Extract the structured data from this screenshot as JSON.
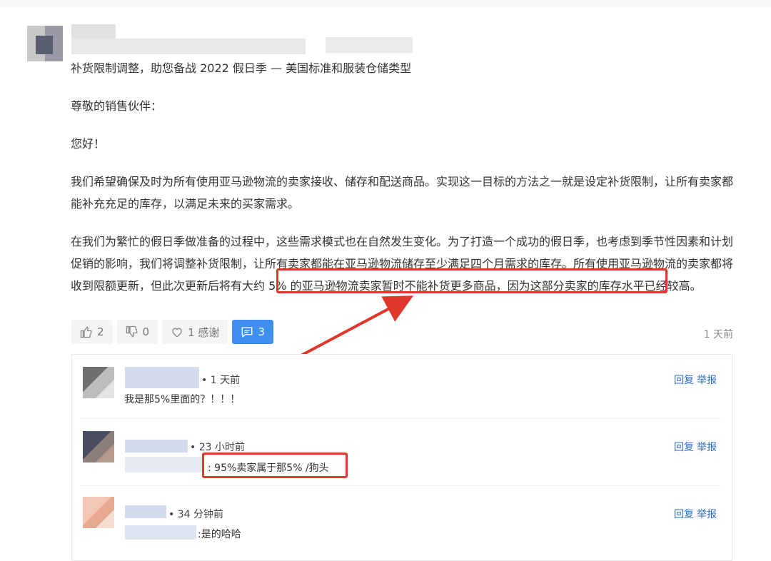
{
  "post": {
    "title": "补货限制调整，助您备战 2022 假日季 — 美国标准和服装仓储类型",
    "greeting1": "尊敬的销售伙伴：",
    "greeting2": "您好！",
    "para1": "我们希望确保及时为所有使用亚马逊物流的卖家接收、储存和配送商品。实现这一目标的方法之一就是设定补货限制，让所有卖家都能补充充足的库存，以满足未来的买家需求。",
    "para2_before": "在我们为繁忙的假日季做准备的过程中，这些需求模式也在自然发生变化。为了打造一个成功的假日季，也考虑到季节性因素和计划促销的影响，我们将调整补货限制，让所有卖家都能在亚马逊物流储存至少满足四个月需求的库存。所有使用亚马逊物流的卖家都将收到限额更新，",
    "para2_highlight": "但此次更新后将有大约 5% 的亚马逊物流卖家暂时不能补货更多商品，",
    "para2_after": "因为这部分卖家的库存水平已经较高。"
  },
  "actions": {
    "like_count": "2",
    "dislike_count": "0",
    "thanks_label": "1 感谢",
    "comment_count": "3",
    "posted_time": "1 天前"
  },
  "comments": [
    {
      "time": "• 1 天前",
      "text": "我是那5%里面的？！！！",
      "reply": "回复",
      "report": "举报"
    },
    {
      "time": "• 23 小时前",
      "text": ": 95%卖家属于那5% /狗头",
      "reply": "回复",
      "report": "举报"
    },
    {
      "time": "• 34 分钟前",
      "text": ":是的哈哈",
      "reply": "回复",
      "report": "举报"
    }
  ],
  "colors": {
    "accent": "#3f8ff2",
    "annotation_red": "#e0362c",
    "link": "#2e6dc4"
  },
  "icons": [
    "thumbs-up-icon",
    "thumbs-down-icon",
    "heart-icon",
    "comment-icon"
  ]
}
